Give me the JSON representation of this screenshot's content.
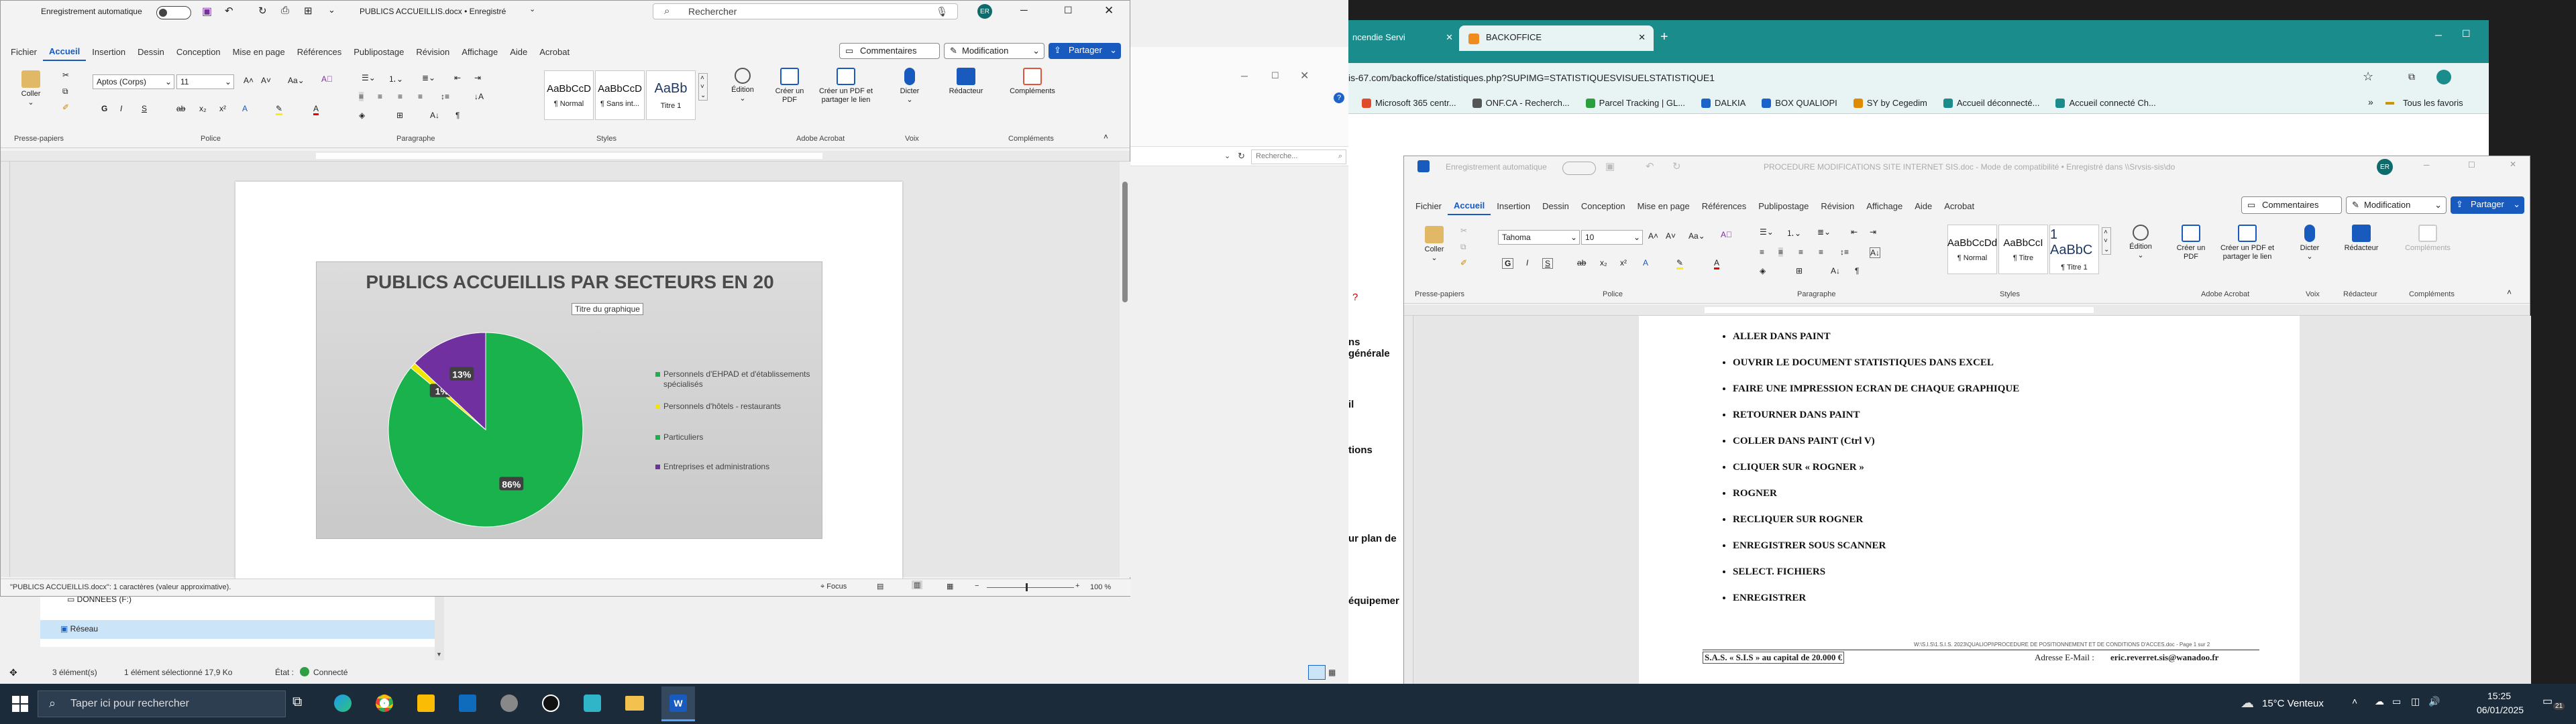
{
  "word_left": {
    "autosave_label": "Enregistrement automatique",
    "doc_title": "PUBLICS ACCUEILLIS.docx • Enregistré",
    "search_placeholder": "Rechercher",
    "avatar": "ER",
    "tabs": [
      "Fichier",
      "Accueil",
      "Insertion",
      "Dessin",
      "Conception",
      "Mise en page",
      "Références",
      "Publipostage",
      "Révision",
      "Affichage",
      "Aide",
      "Acrobat"
    ],
    "comments_btn": "Commentaires",
    "modification_btn": "Modification",
    "share_btn": "Partager",
    "font_name": "Aptos (Corps)",
    "font_size": "11",
    "coller": "Coller",
    "groups": {
      "presse": "Presse-papiers",
      "police": "Police",
      "paragraphe": "Paragraphe",
      "styles": "Styles",
      "acrobat": "Adobe Acrobat",
      "voix": "Voix",
      "complements": "Compléments"
    },
    "styles": [
      {
        "preview": "AaBbCcD",
        "name": "¶ Normal"
      },
      {
        "preview": "AaBbCcD",
        "name": "¶ Sans int..."
      },
      {
        "preview": "AaBb",
        "name": "Titre 1"
      }
    ],
    "edition": "Édition",
    "creer_pdf": "Créer un PDF",
    "creer_pdf_partager": "Créer un PDF et partager le lien",
    "dicter": "Dicter",
    "redacteur": "Rédacteur",
    "complements": "Compléments",
    "status_left": "\"PUBLICS ACCUEILLIS.docx\": 1 caractères (valeur approximative).",
    "focus": "Focus",
    "zoom": "100 %",
    "tooltip": "Titre du graphique"
  },
  "chart_data": {
    "type": "pie",
    "title": "PUBLICS ACCUEILLIS PAR SECTEURS EN 20",
    "categories": [
      "Personnels d'EHPAD et d'établissements spécialisés",
      "Personnels d'hôtels - restaurants",
      "Particuliers",
      "Entreprises et administrations"
    ],
    "values": [
      86,
      1,
      0,
      13
    ],
    "data_labels": [
      "86%",
      "1%",
      "",
      "13%"
    ],
    "colors": [
      "#1ab24c",
      "#f2e600",
      "#1ab24c",
      "#7030a0"
    ],
    "legend": "right"
  },
  "explorer": {
    "drive": "DONNÉES (F:)",
    "network": "Réseau",
    "status_count": "3 élément(s)",
    "status_selected": "1 élément sélectionné  17,9 Ko",
    "status_state": "État :",
    "status_connected": "Connecté",
    "search": "Recherche..."
  },
  "browser": {
    "tab_left": "ncendie Servi",
    "tab_active": "BACKOFFICE",
    "url": "is-67.com/backoffice/statistiques.php?SUPIMG=STATISTIQUESVISUELSTATISTIQUE1",
    "bookmarks": [
      "Microsoft 365 centr...",
      "ONF.CA - Recherch...",
      "Parcel Tracking | GL...",
      "DALKIA",
      "BOX QUALIOPI",
      "SY by Cegedim",
      "Accueil déconnecté...",
      "Accueil connecté Ch..."
    ],
    "all_favorites": "Tous les favoris",
    "side_texts": [
      "ns générale",
      "il",
      "tions",
      "ur plan de",
      "équipemer"
    ]
  },
  "word_right": {
    "autosave_label": "Enregistrement automatique",
    "doc_title": "PROCEDURE MODIFICATIONS SITE INTERNET SIS.doc - Mode de compatibilité • Enregistré dans \\\\Srvsis-sis\\do",
    "avatar": "ER",
    "tabs": [
      "Fichier",
      "Accueil",
      "Insertion",
      "Dessin",
      "Conception",
      "Mise en page",
      "Références",
      "Publipostage",
      "Révision",
      "Affichage",
      "Aide",
      "Acrobat"
    ],
    "comments_btn": "Commentaires",
    "modification_btn": "Modification",
    "share_btn": "Partager",
    "font_name": "Tahoma",
    "font_size": "10",
    "coller": "Coller",
    "groups": {
      "presse": "Presse-papiers",
      "police": "Police",
      "paragraphe": "Paragraphe",
      "styles": "Styles",
      "acrobat": "Adobe Acrobat",
      "voix": "Voix",
      "redacteur": "Rédacteur",
      "complements": "Compléments"
    },
    "styles": [
      {
        "preview": "AaBbCcDd",
        "name": "¶ Normal"
      },
      {
        "preview": "AaBbCcI",
        "name": "¶ Titre"
      },
      {
        "preview": "1  AaBbC",
        "name": "¶ Titre 1"
      }
    ],
    "edition": "Édition",
    "creer_pdf": "Créer un PDF",
    "creer_pdf_partager": "Créer un PDF et partager le lien",
    "dicter": "Dicter",
    "redacteur": "Rédacteur",
    "complements": "Compléments",
    "steps": [
      "ALLER DANS PAINT",
      "OUVRIR LE DOCUMENT STATISTIQUES DANS EXCEL",
      "FAIRE UNE IMPRESSION ECRAN DE CHAQUE GRAPHIQUE",
      "RETOURNER DANS PAINT",
      "COLLER DANS PAINT (Ctrl V)",
      "CLIQUER SUR « ROGNER »",
      "ROGNER",
      "RECLIQUER SUR ROGNER",
      "ENREGISTRER SOUS SCANNER",
      "SELECT. FICHIERS",
      "ENREGISTRER"
    ],
    "footer_small": "W:\\S.I.S\\1.S.I.S. 2023\\QUALIOPI\\PROCEDURE DE POSITIONNEMENT ET DE CONDITIONS D'ACCES.doc - Page 1 sur 2",
    "footer_left": "S.A.S. « S.I.S » au capital de 20.000 €",
    "footer_right_label": "Adresse E-Mail :",
    "footer_right_value": "eric.reverret.sis@wanadoo.fr"
  },
  "taskbar": {
    "search_placeholder": "Taper ici pour rechercher",
    "weather": "15°C  Venteux",
    "time": "15:25",
    "date": "06/01/2025",
    "notif": "21"
  },
  "colors": {
    "word_blue": "#185abd",
    "accent": "#185abd",
    "taskbar": "#1c2b3a"
  }
}
